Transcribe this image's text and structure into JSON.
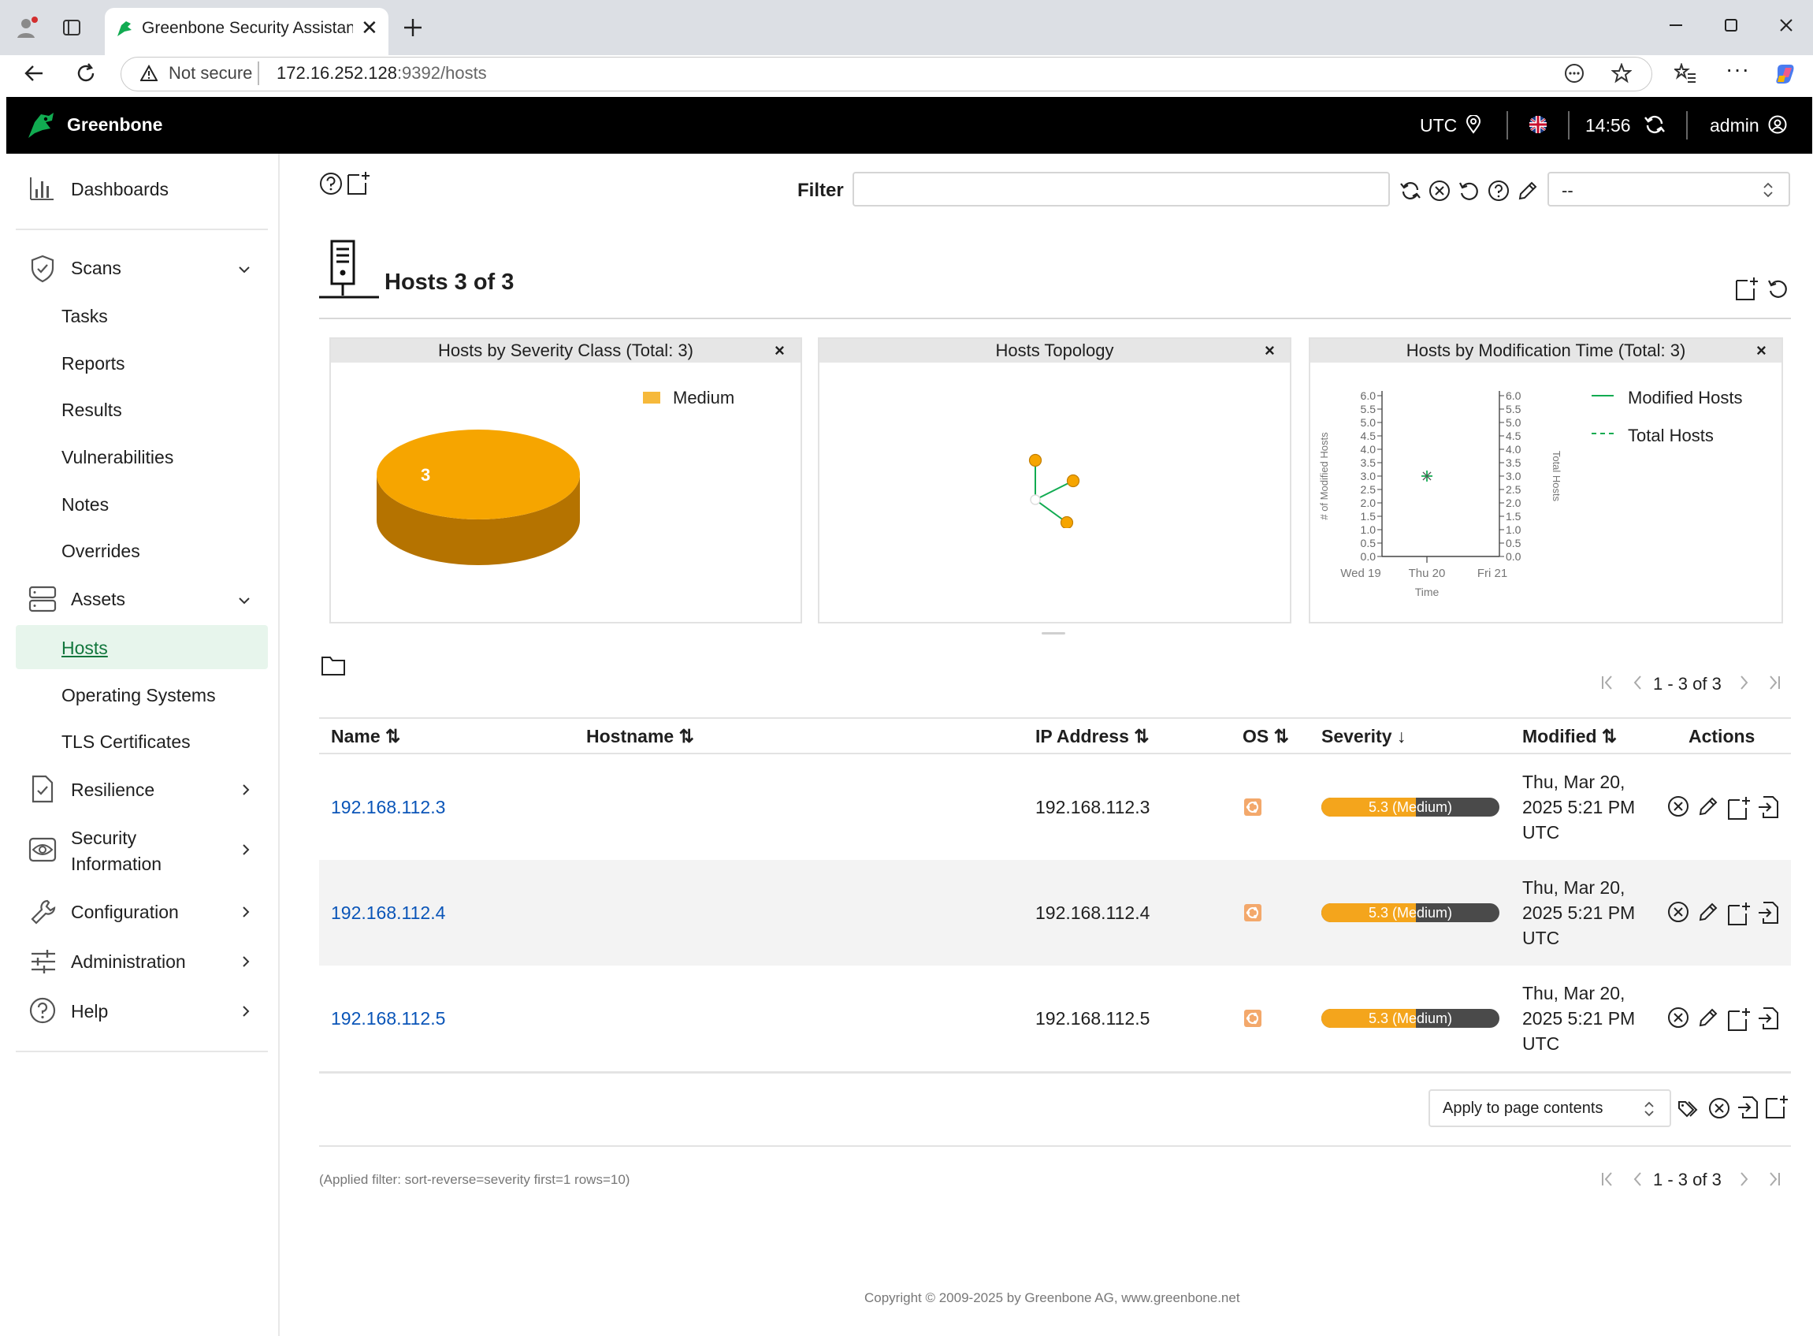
{
  "browser": {
    "tab_title": "Greenbone Security Assistant - Hosts",
    "url_warning": "Not secure",
    "url_host": "172.16.252.128",
    "url_rest": ":9392/hosts"
  },
  "header": {
    "brand": "Greenbone",
    "timezone": "UTC",
    "time": "14:56",
    "user": "admin"
  },
  "sidebar": {
    "dashboards": "Dashboards",
    "scans": "Scans",
    "scan_items": [
      "Tasks",
      "Reports",
      "Results",
      "Vulnerabilities",
      "Notes",
      "Overrides"
    ],
    "assets": "Assets",
    "asset_items": [
      "Hosts",
      "Operating Systems",
      "TLS Certificates"
    ],
    "resilience": "Resilience",
    "security_info_line1": "Security",
    "security_info_line2": "Information",
    "configuration": "Configuration",
    "administration": "Administration",
    "help": "Help"
  },
  "toolbar": {
    "filter_label": "Filter",
    "filter_value": "",
    "filter_select": "--"
  },
  "page": {
    "title": "Hosts 3 of 3"
  },
  "charts": {
    "severity": {
      "title": "Hosts by Severity Class (Total: 3)",
      "close": "×",
      "legend": "Medium",
      "slice_label": "3"
    },
    "topology": {
      "title": "Hosts Topology",
      "close": "×"
    },
    "modtime": {
      "title": "Hosts by Modification Time (Total: 3)",
      "close": "×",
      "legend_modified": "Modified Hosts",
      "legend_total": "Total Hosts",
      "ylabel_left": "# of Modified Hosts",
      "ylabel_right": "Total Hosts",
      "xlabel": "Time"
    }
  },
  "chart_data": [
    {
      "type": "pie",
      "title": "Hosts by Severity Class (Total: 3)",
      "slices": [
        {
          "label": "Medium",
          "value": 3,
          "color": "#f6a500"
        }
      ]
    },
    {
      "type": "line",
      "title": "Hosts by Modification Time (Total: 3)",
      "xlabel": "Time",
      "ylabel": "# of Modified Hosts",
      "ylabel_right": "Total Hosts",
      "x_ticks": [
        "Wed 19",
        "Thu 20",
        "Fri 21"
      ],
      "y_ticks": [
        "0.0",
        "0.5",
        "1.0",
        "1.5",
        "2.0",
        "2.5",
        "3.0",
        "3.5",
        "4.0",
        "4.5",
        "5.0",
        "5.5",
        "6.0"
      ],
      "ylim": [
        0,
        6
      ],
      "series": [
        {
          "name": "Modified Hosts",
          "x": [
            "Thu 20"
          ],
          "values": [
            3
          ]
        },
        {
          "name": "Total Hosts",
          "x": [
            "Thu 20"
          ],
          "values": [
            3
          ]
        }
      ]
    }
  ],
  "pagination": {
    "text": "1 - 3 of 3"
  },
  "table": {
    "headers": {
      "name": "Name",
      "hostname": "Hostname",
      "ip": "IP Address",
      "os": "OS",
      "severity": "Severity",
      "modified": "Modified",
      "actions": "Actions"
    },
    "rows": [
      {
        "name": "192.168.112.3",
        "hostname": "",
        "ip": "192.168.112.3",
        "severity_text": "5.3 (Medium)",
        "severity_value": 5.3,
        "mod1": "Thu, Mar 20,",
        "mod2": "2025 5:21 PM",
        "mod3": "UTC"
      },
      {
        "name": "192.168.112.4",
        "hostname": "",
        "ip": "192.168.112.4",
        "severity_text": "5.3 (Medium)",
        "severity_value": 5.3,
        "mod1": "Thu, Mar 20,",
        "mod2": "2025 5:21 PM",
        "mod3": "UTC"
      },
      {
        "name": "192.168.112.5",
        "hostname": "",
        "ip": "192.168.112.5",
        "severity_text": "5.3 (Medium)",
        "severity_value": 5.3,
        "mod1": "Thu, Mar 20,",
        "mod2": "2025 5:21 PM",
        "mod3": "UTC"
      }
    ]
  },
  "bulk": {
    "select_value": "Apply to page contents"
  },
  "footer": {
    "applied_filter": "(Applied filter: sort-reverse=severity first=1 rows=10)",
    "copyright": "Copyright © 2009-2025 by Greenbone AG, www.greenbone.net"
  },
  "colors": {
    "accent_green": "#11ab51",
    "severity_medium": "#f4a51c",
    "link_blue": "#0a55b8"
  }
}
